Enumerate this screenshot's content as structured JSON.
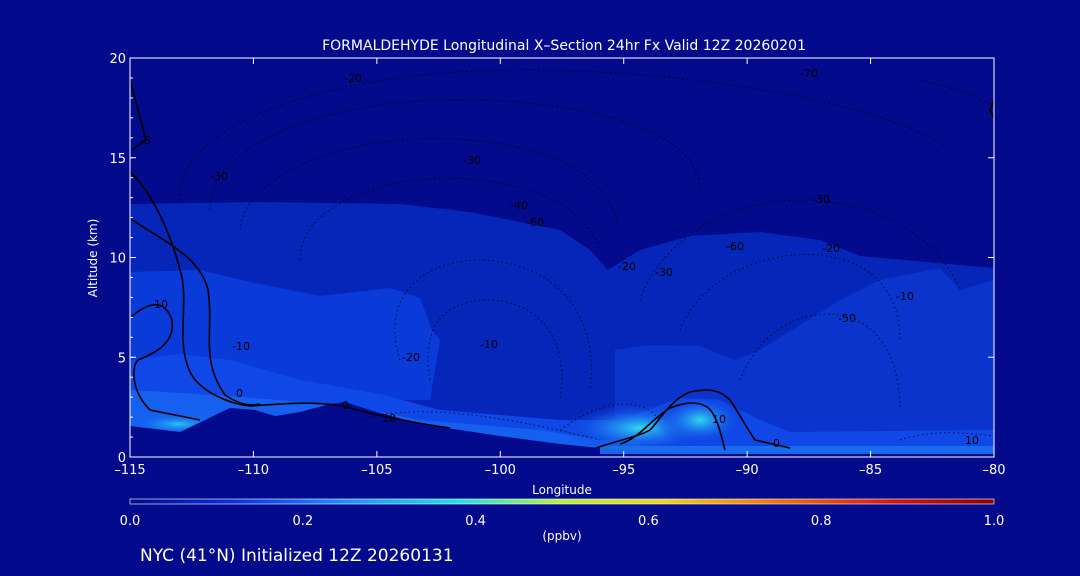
{
  "chart_data": {
    "type": "heatmap",
    "title": "FORMALDEHYDE Longitudinal X–Section 24hr  Fx Valid 12Z 20260201",
    "xlabel": "Longitude",
    "ylabel": "Altitude (km)",
    "xlim": [
      -115,
      -80
    ],
    "ylim": [
      0,
      20
    ],
    "x_ticks": [
      "–115",
      "–110",
      "–105",
      "–100",
      "–95",
      "–90",
      "–85",
      "–80"
    ],
    "y_ticks": [
      "0",
      "5",
      "10",
      "15",
      "20"
    ],
    "colorbar": {
      "label": "(ppbv)",
      "min": 0.0,
      "max": 1.0,
      "ticks": [
        "0.0",
        "0.2",
        "0.4",
        "0.6",
        "0.8",
        "1.0"
      ],
      "colors": [
        "#030a8c",
        "#0a2fe0",
        "#1e90ff",
        "#20e0e8",
        "#b8f040",
        "#f0d020",
        "#f07010",
        "#d01818",
        "#8c0000"
      ]
    },
    "contour_labels": [
      "-20",
      "-70",
      "-30",
      "-30",
      "-30",
      "-40",
      "-60",
      "-60",
      "-20",
      "-20",
      "-30",
      "-10",
      "-50",
      "-20",
      "-10",
      "-10",
      "-5",
      "0",
      "0",
      "10",
      "0",
      "10",
      "10",
      "-10"
    ],
    "field_regions": [
      {
        "lon": [
          -115,
          -99
        ],
        "alt": [
          0.5,
          12.7
        ],
        "value": 0.1
      },
      {
        "lon": [
          -98.5,
          -88
        ],
        "alt": [
          0.2,
          11.3
        ],
        "value": 0.1
      },
      {
        "lon": [
          -115,
          -112
        ],
        "alt": [
          1.2,
          3.5
        ],
        "value": 0.25
      },
      {
        "lon": [
          -97,
          -91
        ],
        "alt": [
          0.3,
          2.2
        ],
        "value": 0.3
      }
    ]
  },
  "footer": {
    "caption": "NYC (41°N) Initialized 12Z 20260131"
  }
}
